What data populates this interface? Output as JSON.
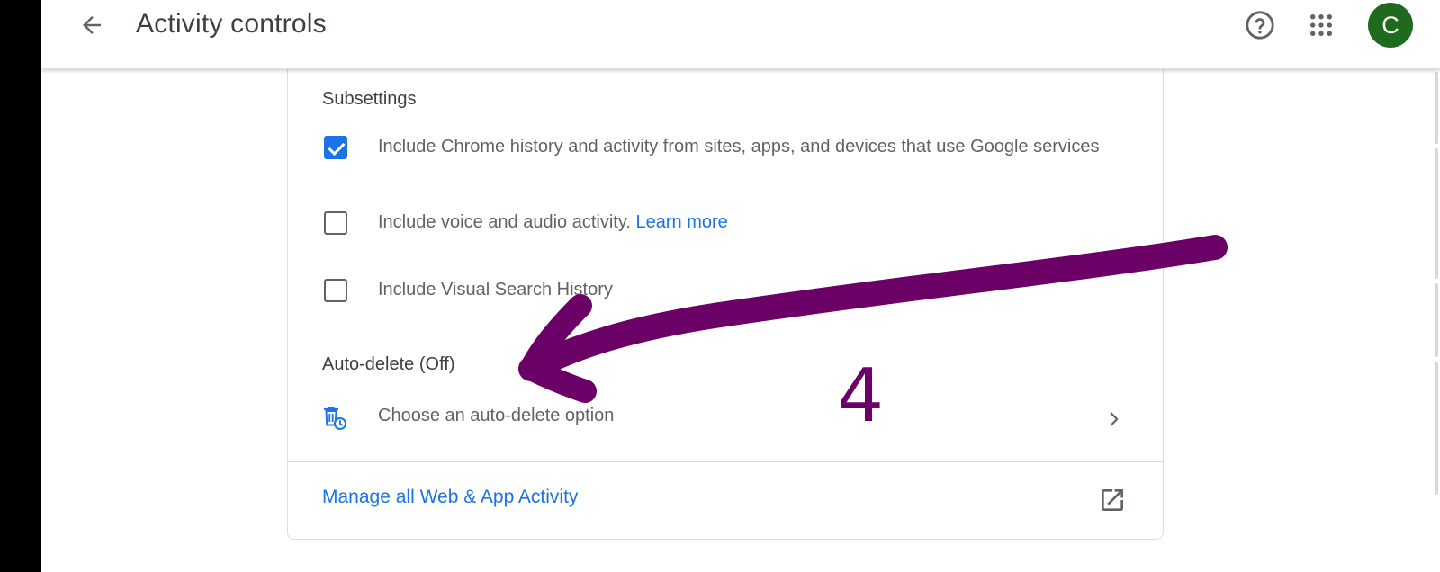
{
  "header": {
    "title": "Activity controls",
    "avatar_initial": "C",
    "icons": {
      "back": "arrow-left-icon",
      "help": "help-circle-icon",
      "apps": "apps-grid-icon"
    }
  },
  "card": {
    "subsettings": {
      "heading": "Subsettings",
      "items": [
        {
          "label": "Include Chrome history and activity from sites, apps, and devices that use Google services",
          "checked": true
        },
        {
          "label": "Include voice and audio activity.",
          "link": "Learn more",
          "checked": false
        },
        {
          "label": "Include Visual Search History",
          "checked": false
        }
      ]
    },
    "autodelete": {
      "heading": "Auto-delete (Off)",
      "option_label": "Choose an auto-delete option",
      "icon": "auto-delete-icon"
    },
    "manage": {
      "label": "Manage all Web & App Activity",
      "icon": "open-in-new-icon"
    }
  },
  "annotation": {
    "text": "4",
    "color": "#6b0067"
  },
  "colors": {
    "accent": "#1a73e8",
    "avatar": "#1e6b1e",
    "text": "#3c4043",
    "secondary": "#5f6368"
  }
}
